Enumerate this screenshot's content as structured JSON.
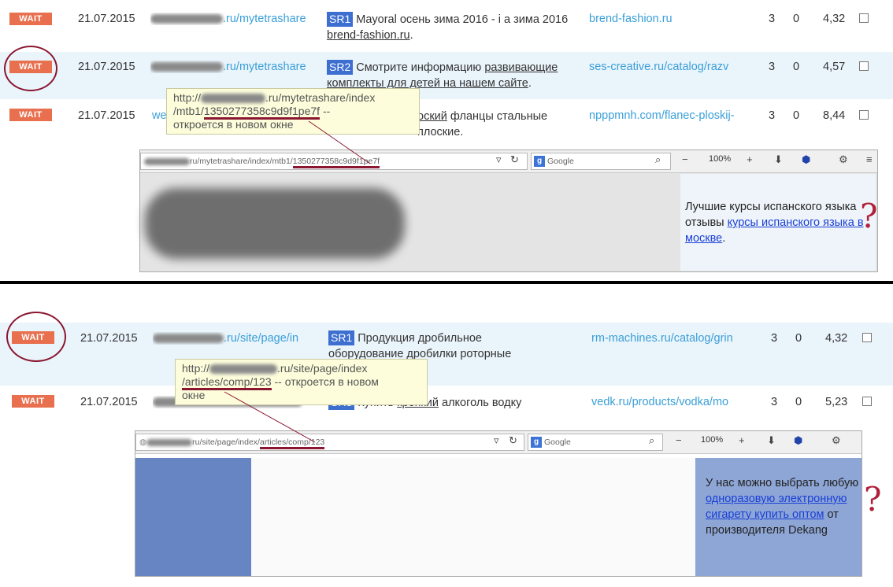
{
  "top": {
    "rows": [
      {
        "badge": "WAIT",
        "date": "21.07.2015",
        "url_visible": ".ru/mytetrashare",
        "sr": "SR1",
        "title_pre": "Mayoral осень зима 2016 - i а зима 2016 ",
        "title_link": "brend-fashion.ru",
        "title_post": ".",
        "target": "brend-fashion.ru",
        "c1": "3",
        "c2": "0",
        "score": "4,32"
      },
      {
        "badge": "WAIT",
        "date": "21.07.2015",
        "url_visible": ".ru/mytetrashare",
        "sr": "SR2",
        "title_pre": "Смотрите информацию ",
        "title_link": "развивающие комплекты для детей на нашем сайте",
        "title_post": ".",
        "target": "ses-creative.ru/catalog/razv",
        "c1": "3",
        "c2": "0",
        "score": "4,57"
      },
      {
        "badge": "WAIT",
        "date": "21.07.2015",
        "url_visible": "we",
        "sr": "",
        "title_pre": "",
        "title_link": "оский",
        "title_post": " фланцы стальные плоские.",
        "target": "npppmnh.com/flanec-ploskij-",
        "c1": "3",
        "c2": "0",
        "score": "8,44"
      }
    ],
    "tooltip": {
      "line1": "http://",
      "line1b": ".ru/mytetrashare/index",
      "line2a": "/mtb1/",
      "line2b": "1350277358c9d9f1pe7f",
      "line2c": " --",
      "line3": "откроется в новом окне"
    },
    "browser": {
      "address_suffix": "ru/mytetrashare/index/mtb1/",
      "address_id": "1350277358c9d9f1pe7f",
      "search_engine": "Google",
      "zoom": "100%",
      "ad_text": "Лучшие курсы испанского языка отзывы ",
      "ad_link": "курсы испанского языка в москве",
      "ad_end": "."
    },
    "question": "?"
  },
  "bottom": {
    "rows": [
      {
        "badge": "WAIT",
        "date": "21.07.2015",
        "url_visible": ".ru/site/page/in",
        "sr": "SR1",
        "title_pre": "Продукция дробильное оборудование дробилки роторные",
        "title_link": "",
        "title_post": "",
        "target": "rm-machines.ru/catalog/grin",
        "c1": "3",
        "c2": "0",
        "score": "4,32"
      },
      {
        "badge": "WAIT",
        "date": "21.07.2015",
        "url_visible": "",
        "sr": "SR3",
        "title_pre": "Купить ",
        "title_link": "крепкий",
        "title_post": " алкоголь водку",
        "target": "vedk.ru/products/vodka/mo",
        "c1": "3",
        "c2": "0",
        "score": "5,23"
      }
    ],
    "tooltip": {
      "line1": "http://",
      "line1b": ".ru/site/page/index",
      "line2a": "/articles/comp/123",
      "line2c": " -- откроется в новом",
      "line3": "окне"
    },
    "browser": {
      "address_suffix": "ru/site/page/index/",
      "address_id": "articles/comp/123",
      "search_engine": "Google",
      "zoom": "100%",
      "ad_text": "У нас можно выбрать любую ",
      "ad_link": "одноразовую электронную сигарету купить оптом",
      "ad_end": " от производителя Dekang"
    },
    "question": "?"
  },
  "colors": {
    "badge": "#e8704f",
    "sr": "#3d6fd1",
    "link": "#3a9fd8",
    "annotation": "#8a1630"
  }
}
